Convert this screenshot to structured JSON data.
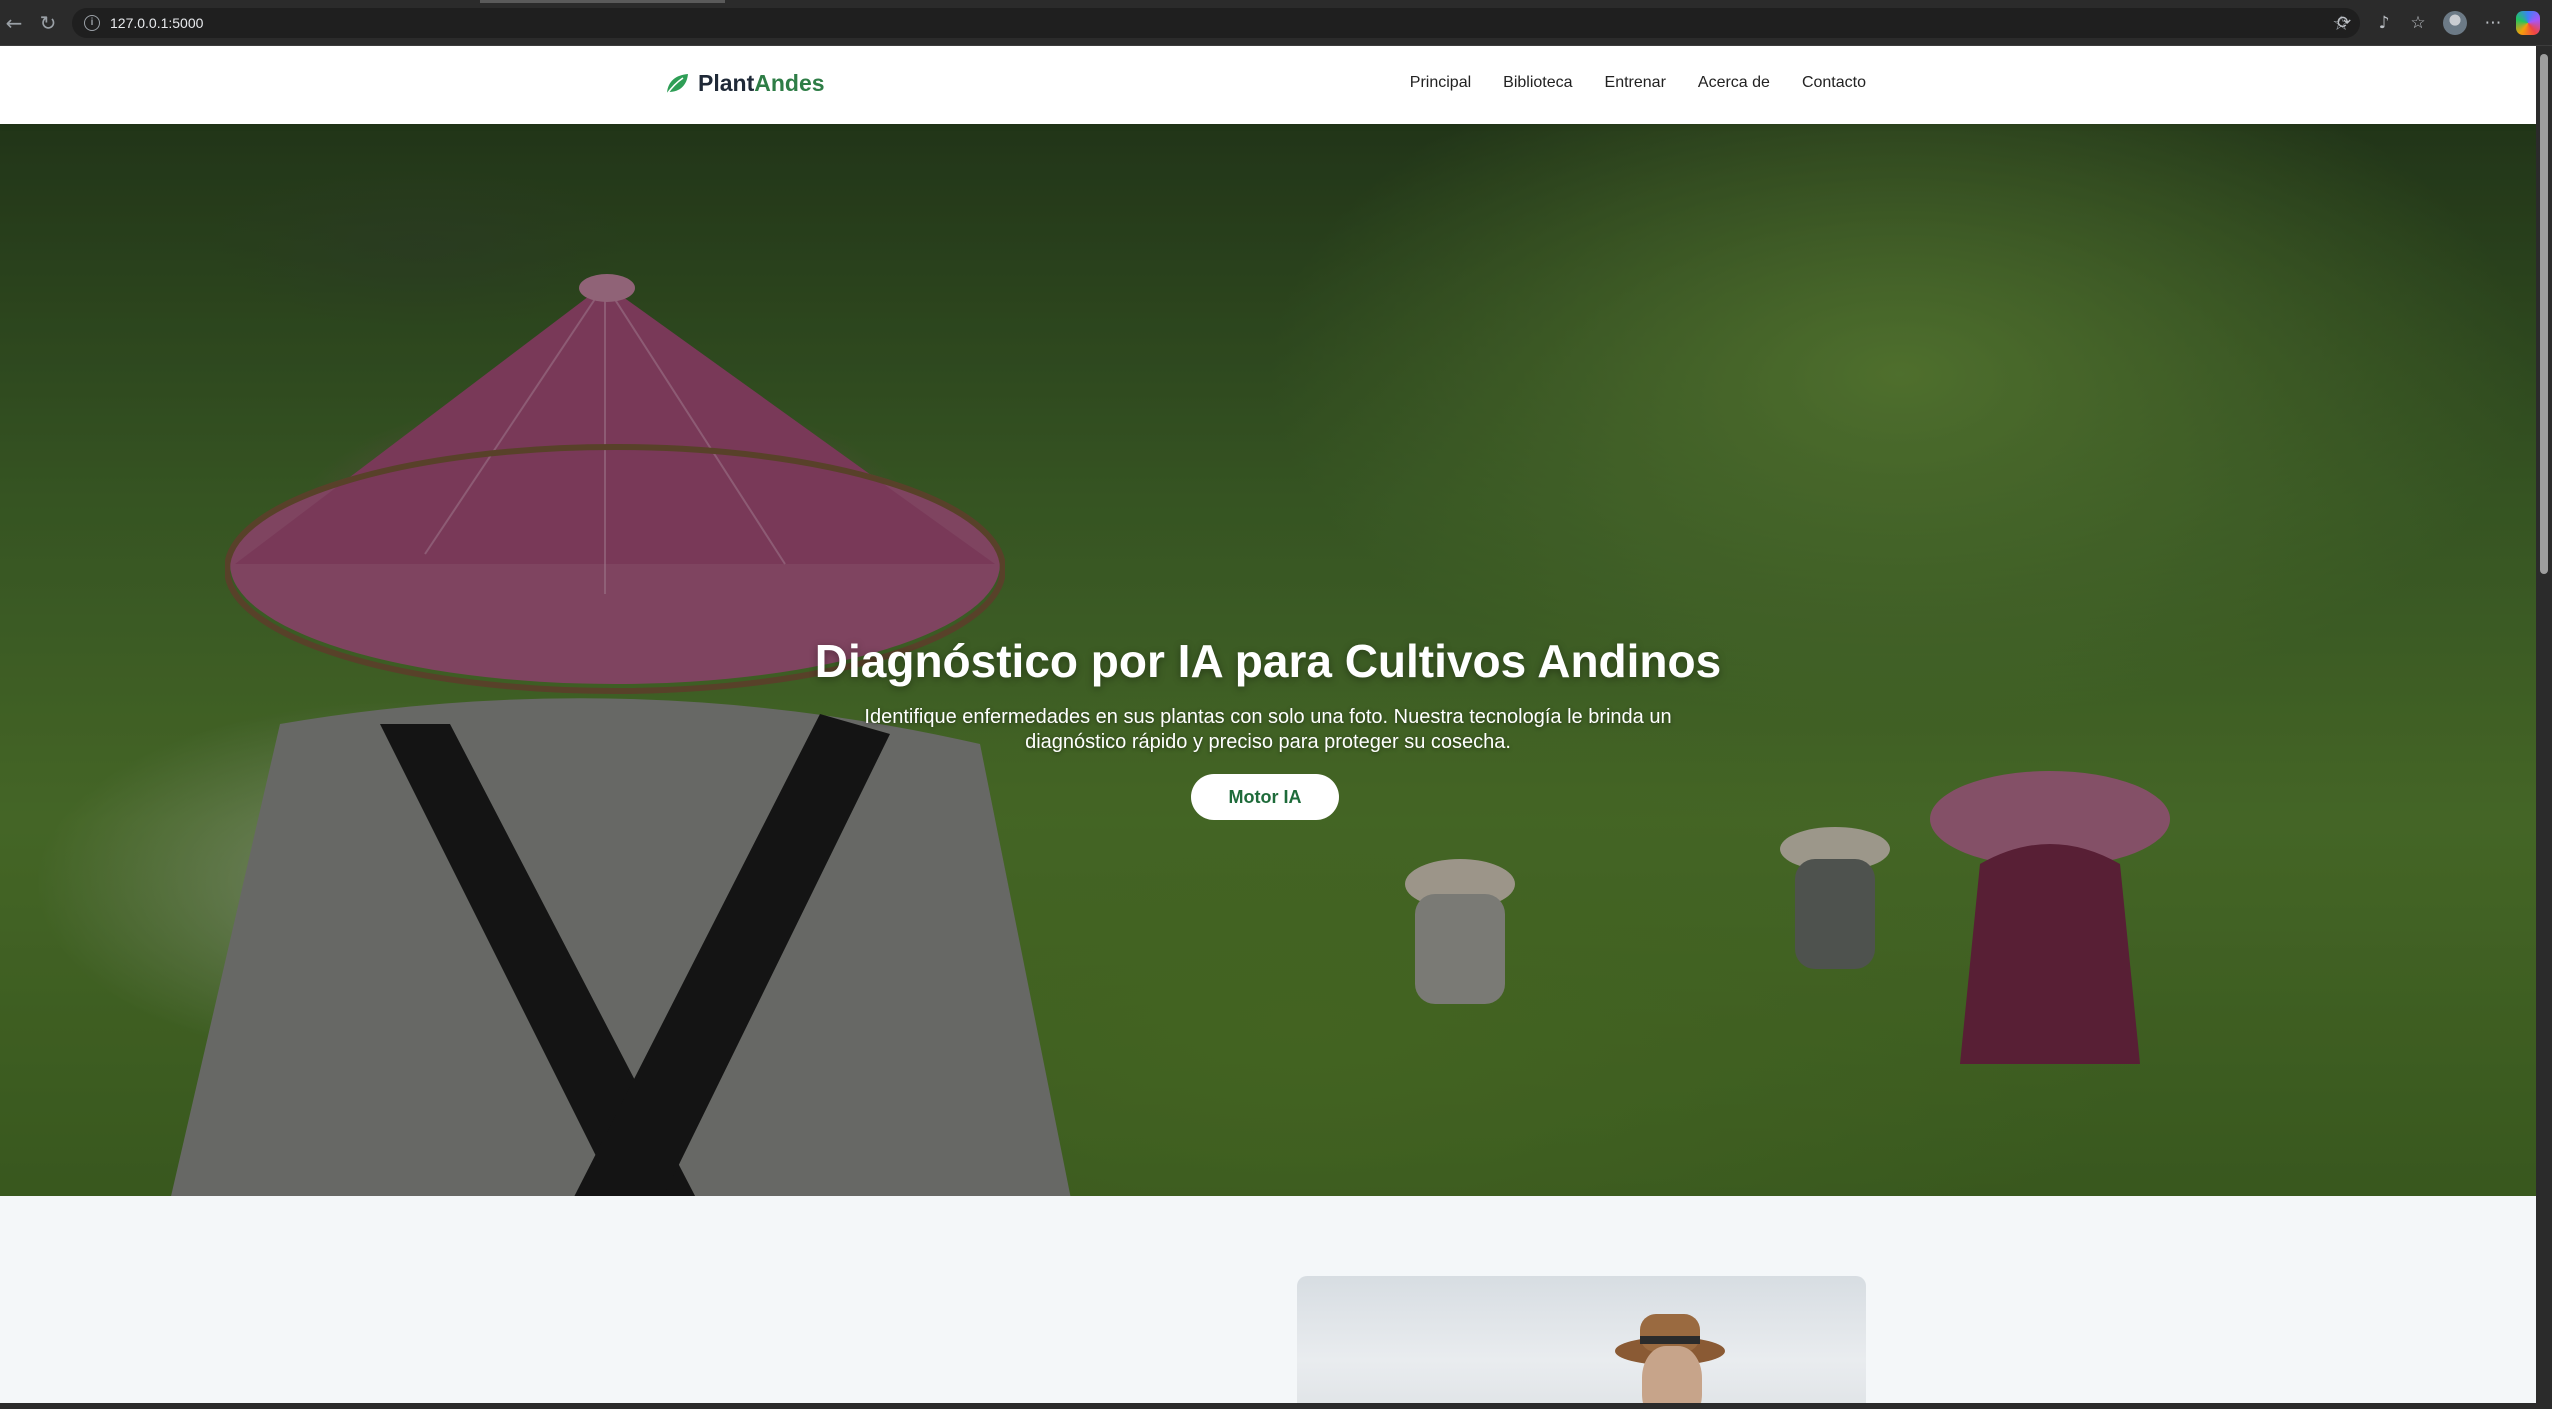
{
  "browser": {
    "url": "127.0.0.1:5000"
  },
  "navbar": {
    "brand_part1": "Plant",
    "brand_part2": "Andes",
    "links": [
      "Principal",
      "Biblioteca",
      "Entrenar",
      "Acerca de",
      "Contacto"
    ]
  },
  "hero": {
    "title": "Diagnóstico por IA para Cultivos Andinos",
    "subtitle": "Identifique enfermedades en sus plantas con solo una foto. Nuestra tecnología le brinda un diagnóstico rápido y preciso para proteger su cosecha.",
    "button_label": "Motor IA"
  },
  "colors": {
    "brand_green": "#2e7d46",
    "button_text": "#1e6b3a"
  }
}
